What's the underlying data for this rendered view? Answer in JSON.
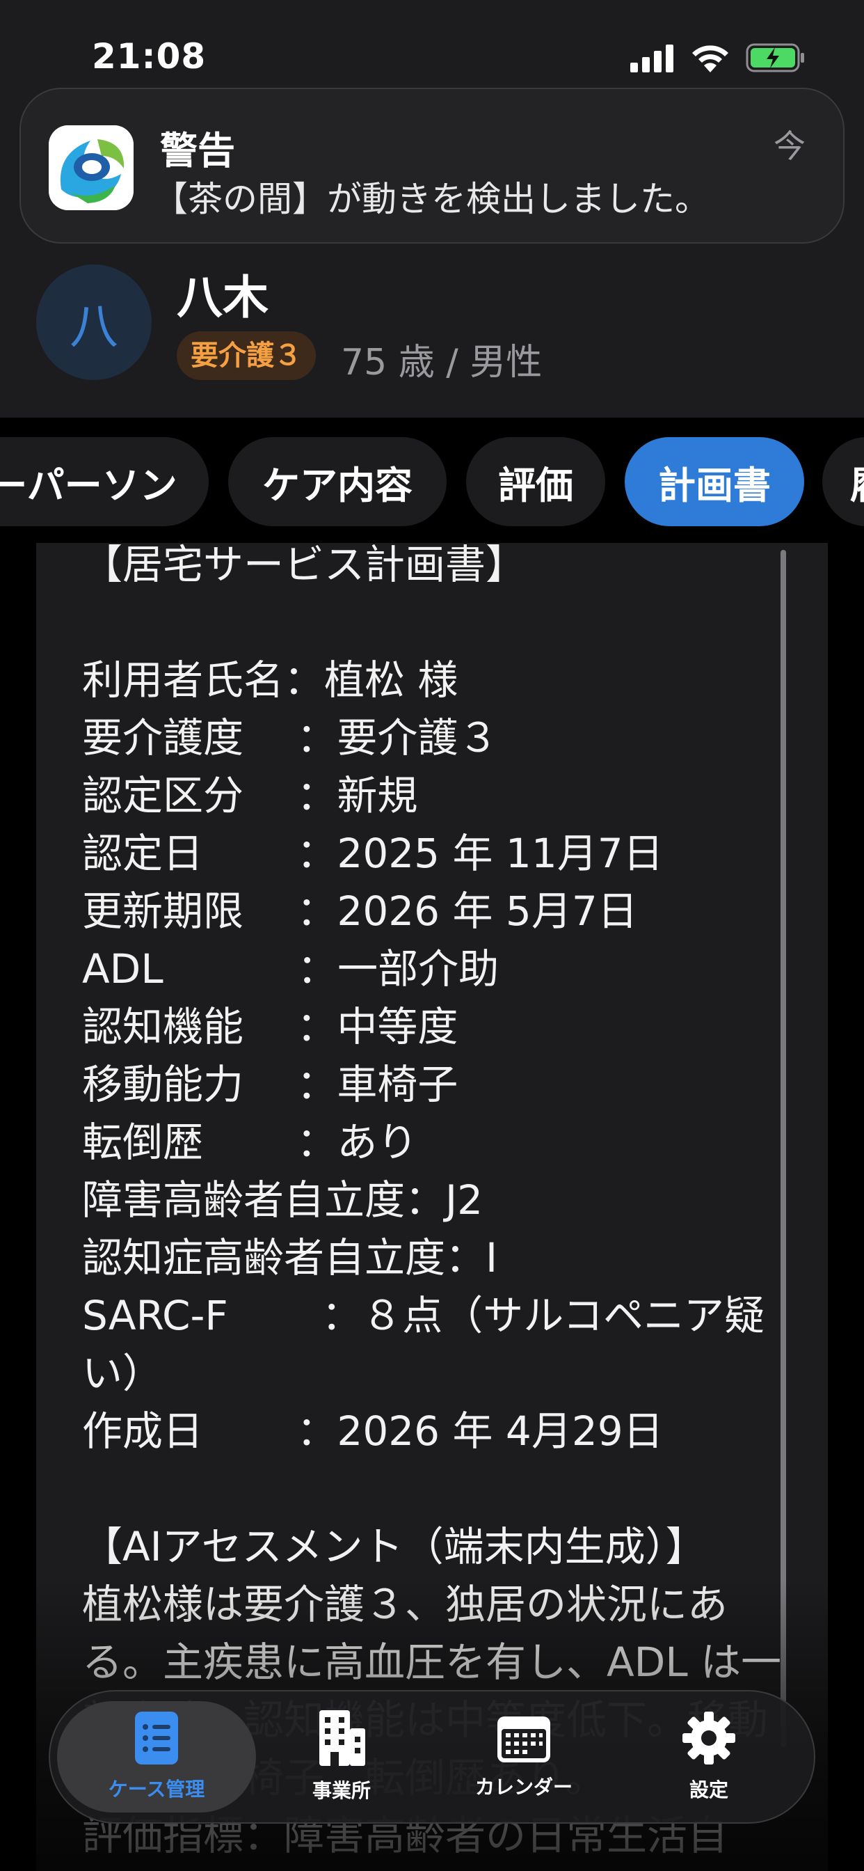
{
  "status_bar": {
    "time": "21:08"
  },
  "notification": {
    "title": "警告",
    "body": "【茶の間】が動きを検出しました。",
    "time": "今"
  },
  "patient": {
    "avatar_initial": "八",
    "name": "八木",
    "care_level": "要介護３",
    "meta": "75 歳 / 男性"
  },
  "tabs": [
    {
      "label": "ーパーソン"
    },
    {
      "label": "ケア内容"
    },
    {
      "label": "評価"
    },
    {
      "label": "計画書",
      "active": true
    },
    {
      "label": "履"
    }
  ],
  "plan": {
    "text": "【居宅サービス計画書】\n\n利用者氏名：植松 様\n要介護度　 ：要介護３\n認定区分　 ：新規\n認定日　　 ：2025 年 11月7日\n更新期限　 ：2026 年 5月7日\nADL　　　 ：一部介助\n認知機能　 ：中等度\n移動能力　 ：車椅子\n転倒歴　　 ：あり\n障害高齢者自立度：J2\n認知症高齢者自立度：Ⅰ\nSARC-F　　 ：８点（サルコペニア疑い）\n作成日　　 ：2026 年 4月29日\n\n【AIアセスメント（端末内生成）】\n植松様は要介護３、独居の状況にある。主疾患に高血圧を有し、ADL は一部介助、認知機能は中等度低下。移動能力は車椅子、転倒歴あり。\n評価指標：障害高齢者の日常生活自"
  },
  "bottom_nav": [
    {
      "label": "ケース管理",
      "icon": "document-list-icon",
      "active": true
    },
    {
      "label": "事業所",
      "icon": "building-icon"
    },
    {
      "label": "カレンダー",
      "icon": "calendar-icon"
    },
    {
      "label": "設定",
      "icon": "gear-icon"
    }
  ],
  "colors": {
    "accent": "#2f7bd8",
    "badge_text": "#f5a042",
    "background": "#1c1c1e"
  }
}
